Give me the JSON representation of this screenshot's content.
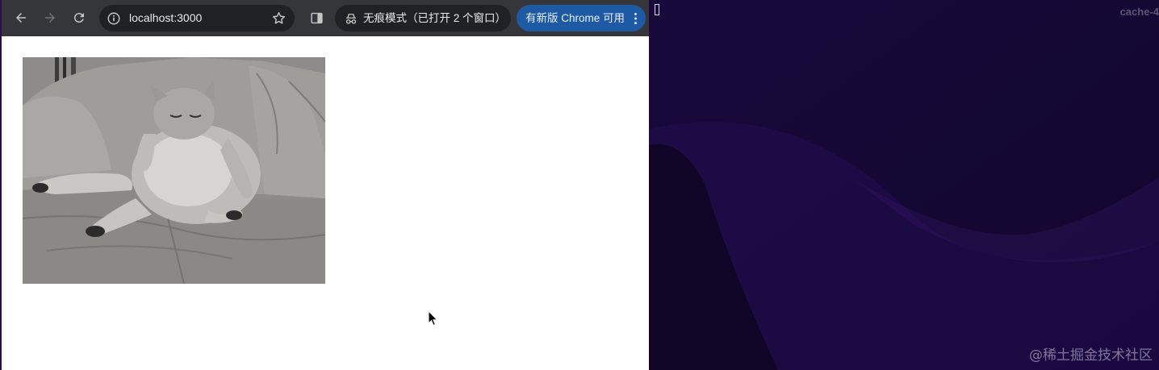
{
  "browser": {
    "url": "localhost:3000",
    "incognito_label": "无痕模式（已打开 2 个窗口）",
    "update_label": "有新版 Chrome 可用",
    "icons": {
      "back": "arrow-left-icon",
      "forward": "arrow-right-icon",
      "reload": "reload-icon",
      "site_info": "site-info-icon",
      "bookmark": "star-icon",
      "side_panel": "side-panel-icon",
      "incognito": "incognito-icon",
      "menu": "more-vert-icon"
    },
    "colors": {
      "toolbar": "#35363a",
      "omnibox": "#202124",
      "update_chip": "#1e5aa3"
    }
  },
  "page": {
    "image": {
      "alt": "cat lounging on a sofa"
    }
  },
  "terminal": {
    "title": "cache-4",
    "background": "#150838"
  },
  "watermark": "@稀土掘金技术社区"
}
